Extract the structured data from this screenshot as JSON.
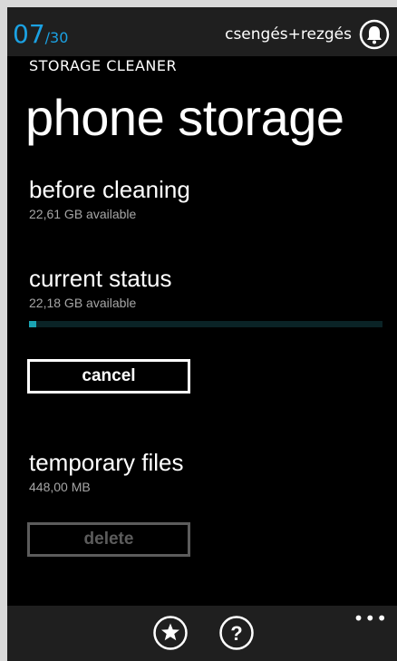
{
  "status_bar": {
    "counter_current": "07",
    "counter_total": "/30",
    "notification_text": "csengés+rezgés",
    "icon": "bell-icon"
  },
  "header": {
    "app_title": "STORAGE CLEANER",
    "page_title": "phone storage"
  },
  "before_cleaning": {
    "heading": "before cleaning",
    "detail": "22,61 GB available"
  },
  "current_status": {
    "heading": "current status",
    "detail": "22,18 GB available",
    "progress_fraction": 0.02
  },
  "cancel_button": {
    "label": "cancel"
  },
  "temporary_files": {
    "heading": "temporary files",
    "detail": "448,00 MB"
  },
  "delete_button": {
    "label": "delete",
    "enabled": false
  },
  "app_bar": {
    "icons": [
      "star-icon",
      "help-icon"
    ],
    "more_label": "•••"
  },
  "colors": {
    "accent": "#1ba1e2",
    "progress": "#1aa3b2",
    "disabled": "#5c5c5c"
  }
}
